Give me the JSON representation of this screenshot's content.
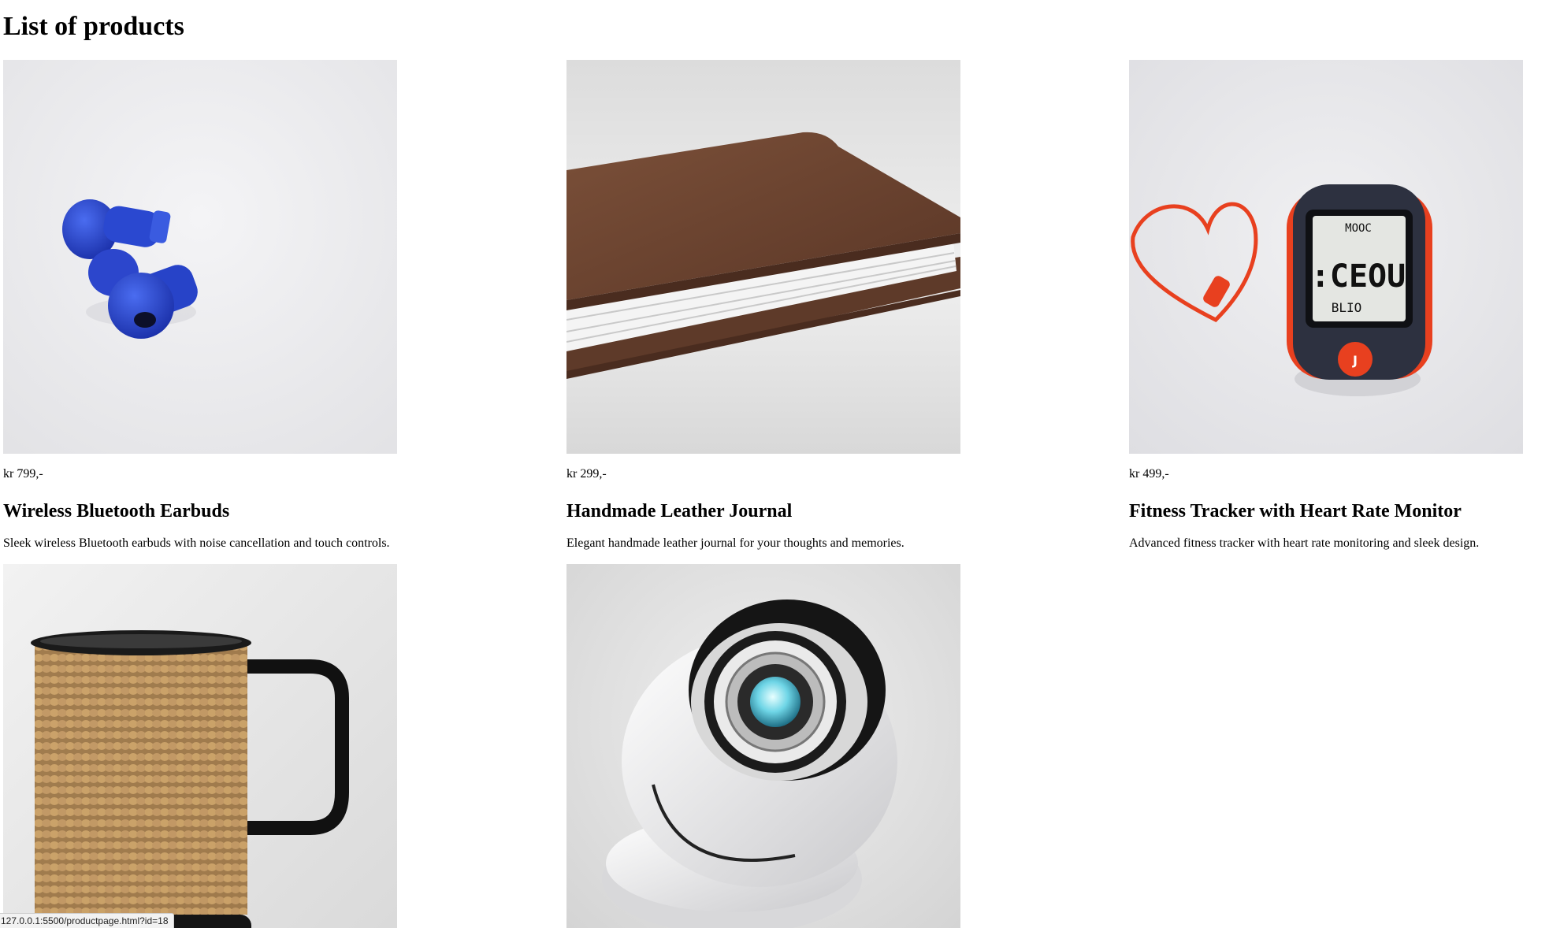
{
  "page": {
    "title": "List of products"
  },
  "products": [
    {
      "price": "kr 799,-",
      "name": "Wireless Bluetooth Earbuds",
      "description": "Sleek wireless Bluetooth earbuds with noise cancellation and touch controls."
    },
    {
      "price": "kr 299,-",
      "name": "Handmade Leather Journal",
      "description": "Elegant handmade leather journal for your thoughts and memories."
    },
    {
      "price": "kr 499,-",
      "name": "Fitness Tracker with Heart Rate Monitor",
      "description": "Advanced fitness tracker with heart rate monitoring and sleek design."
    },
    {
      "price": "",
      "name": "",
      "description": ""
    },
    {
      "price": "",
      "name": "",
      "description": ""
    }
  ],
  "status_bar": {
    "url": "127.0.0.1:5500/productpage.html?id=18"
  },
  "tracker_screen": {
    "top": "MOOC",
    "mid": ":CEOU",
    "low": "BLIO"
  },
  "colors": {
    "earbud_blue": "#2240c8",
    "leather_brown": "#6e4732",
    "tracker_red": "#e8401f",
    "mug_weave": "#b58a4e"
  }
}
